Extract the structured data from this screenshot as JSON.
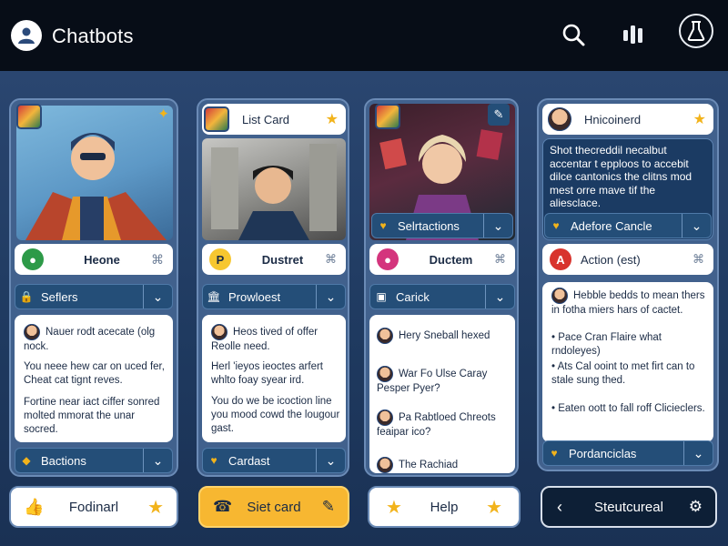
{
  "app": {
    "title": "Chatbots"
  },
  "colors": {
    "topbar": "#070d17",
    "background": "#1d3457",
    "accent_yellow": "#f7b731",
    "dropdown": "#244e78"
  },
  "top_icons": [
    "search-icon",
    "equalizer-icon",
    "user-icon"
  ],
  "columns": [
    {
      "header_label": "Heone",
      "badge_color": "#2d9a48",
      "dropdown1": "Seflers",
      "text": [
        "Nauer rodt acecate (olg nock.",
        "You neee hew car on uced fer, Cheat cat tignt reves.",
        "Fortine near iact ciffer sonred molted mmorat the unar socred."
      ],
      "dropdown2": "Bactions",
      "bottom_label": "Fodinarl"
    },
    {
      "header_label": "List Card",
      "chip_label": "Dustret",
      "chip_badge": "P",
      "dropdown1": "Prowloest",
      "text": [
        "Heos tived of offer Reolle need.",
        "Herl 'ieyos ieoctes arfert whlto foay syear ird.",
        "You do we be icoction line you mood cowd the lougour gast."
      ],
      "dropdown2": "Cardast",
      "bottom_label": "Siet card"
    },
    {
      "header_label": "Selrtactions",
      "chip_label": "Ductem",
      "dropdown1": "Carick",
      "items": [
        "Hery Sneball hexed",
        "War Fo Ulse Caray Pesper Pyer?",
        "Pa Rabtloed Chreots feaipar ico?",
        "The Rachiad"
      ],
      "bottom_label": "Help"
    },
    {
      "header_label": "Hnicoinerd",
      "dark_text": "Shot thecreddil necalbut accentar t epploos to accebit dilce cantonics the clitns mod mest orre mave tif the aliesclace.",
      "sub_label": "Adefore Cancle",
      "chip_label": "Action (est)",
      "chip_badge": "A",
      "intro": "Hebble bedds to mean thers in fotha miers hars of cactet.",
      "bullets": [
        "Pace Cran Flaire what rndoleyes)",
        "Ats Cal ooint to met firt can to stale sung thed.",
        "Eaten oott to fall roff Clicieclers."
      ],
      "dropdown2": "Pordanciclas",
      "bottom_label": "Steutcureal"
    }
  ]
}
